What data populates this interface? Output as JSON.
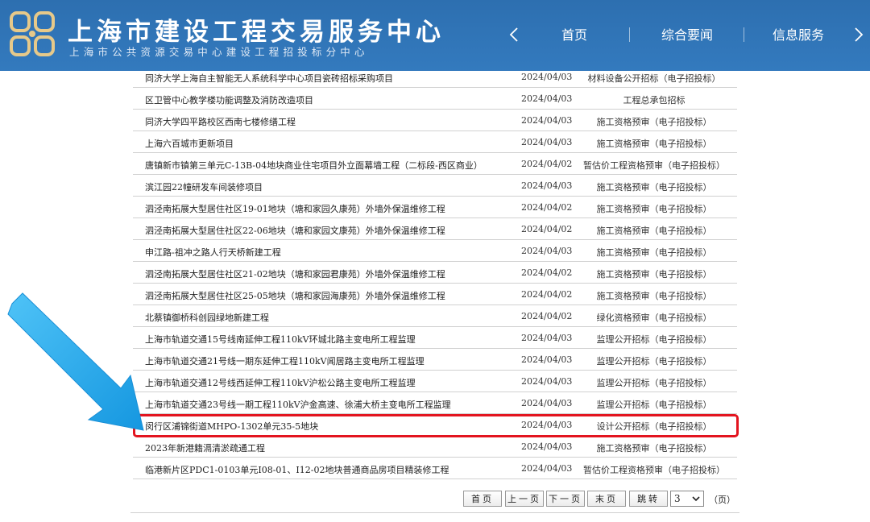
{
  "header": {
    "title": "上海市建设工程交易服务中心",
    "subtitle": "上海市公共资源交易中心建设工程招投标分中心",
    "nav": [
      "首页",
      "综合要闻",
      "信息服务"
    ]
  },
  "rows": [
    {
      "name": "同济大学上海自主智能无人系统科学中心项目瓷砖招标采购项目",
      "date": "2024/04/03",
      "type": "材料设备公开招标（电子招投标）"
    },
    {
      "name": "区卫管中心教学楼功能调整及消防改造项目",
      "date": "2024/04/03",
      "type": "工程总承包招标"
    },
    {
      "name": "同济大学四平路校区西南七楼修缮工程",
      "date": "2024/04/03",
      "type": "施工资格预审（电子招投标）"
    },
    {
      "name": "上海六百城市更新项目",
      "date": "2024/04/03",
      "type": "施工资格预审（电子招投标）"
    },
    {
      "name": "唐镇新市镇第三单元C-13B-04地块商业住宅项目外立面幕墙工程（二标段-西区商业）",
      "date": "2024/04/02",
      "type": "暂估价工程资格预审（电子招投标）"
    },
    {
      "name": "滨江园22幢研发车间装修项目",
      "date": "2024/04/03",
      "type": "施工资格预审（电子招投标）"
    },
    {
      "name": "泗泾南拓展大型居住社区19-01地块（塘和家园久康苑）外墙外保温维修工程",
      "date": "2024/04/02",
      "type": "施工资格预审（电子招投标）"
    },
    {
      "name": "泗泾南拓展大型居住社区22-06地块（塘和家园文康苑）外墙外保温维修工程",
      "date": "2024/04/02",
      "type": "施工资格预审（电子招投标）"
    },
    {
      "name": "申江路-祖冲之路人行天桥新建工程",
      "date": "2024/04/03",
      "type": "施工资格预审（电子招投标）"
    },
    {
      "name": "泗泾南拓展大型居住社区21-02地块（塘和家园君康苑）外墙外保温维修工程",
      "date": "2024/04/02",
      "type": "施工资格预审（电子招投标）"
    },
    {
      "name": "泗泾南拓展大型居住社区25-05地块（塘和家园海康苑）外墙外保温维修工程",
      "date": "2024/04/02",
      "type": "施工资格预审（电子招投标）"
    },
    {
      "name": "北蔡镇御桥科创园绿地新建工程",
      "date": "2024/04/02",
      "type": "绿化资格预审（电子招投标）"
    },
    {
      "name": "上海市轨道交通15号线南延伸工程110kV环城北路主变电所工程监理",
      "date": "2024/04/03",
      "type": "监理公开招标（电子招投标）"
    },
    {
      "name": "上海市轨道交通21号线一期东延伸工程110kV闻居路主变电所工程监理",
      "date": "2024/04/03",
      "type": "监理公开招标（电子招投标）"
    },
    {
      "name": "上海市轨道交通12号线西延伸工程110kV沪松公路主变电所工程监理",
      "date": "2024/04/03",
      "type": "监理公开招标（电子招投标）"
    },
    {
      "name": "上海市轨道交通23号线一期工程110kV沪金高速、徐浦大桥主变电所工程监理",
      "date": "2024/04/03",
      "type": "监理公开招标（电子招投标）"
    },
    {
      "name": "闵行区浦锦街道MHPO-1302单元35-5地块",
      "date": "2024/04/03",
      "type": "设计公开招标（电子招投标）"
    },
    {
      "name": "2023年新港籍滆清淤疏通工程",
      "date": "2024/04/03",
      "type": "施工资格预审（电子招投标）"
    },
    {
      "name": "临港新片区PDC1-0103单元I08-01、I12-02地块普通商品房项目精装修工程",
      "date": "2024/04/03",
      "type": "暂估价工程资格预审（电子招投标）"
    }
  ],
  "pager": {
    "first": "首页",
    "prev": "上一页",
    "next": "下一页",
    "last": "末页",
    "jump": "跳转",
    "page_value": "3",
    "suffix": "（页）"
  },
  "colors": {
    "header_bg": "#1d64aa",
    "highlight": "#e3141f",
    "arrow": "#1aa0e6"
  }
}
